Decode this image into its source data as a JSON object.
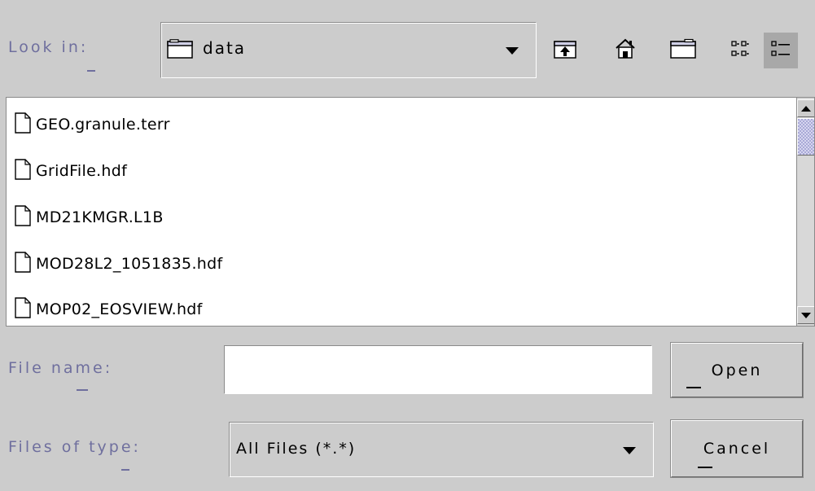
{
  "look_in": {
    "label": "Look in:",
    "folder": "data",
    "folder_icon": "folder-icon"
  },
  "toolbar": {
    "up_icon": "up-one-level-icon",
    "home_icon": "home-icon",
    "new_folder_icon": "new-folder-icon",
    "list_icon": "list-view-icon",
    "details_icon": "details-view-icon",
    "active_view": "details"
  },
  "files": [
    {
      "name": "GEO.granule.terr",
      "icon": "file-icon"
    },
    {
      "name": "GridFile.hdf",
      "icon": "file-icon"
    },
    {
      "name": "MD21KMGR.L1B",
      "icon": "file-icon"
    },
    {
      "name": "MOD28L2_1051835.hdf",
      "icon": "file-icon"
    },
    {
      "name": "MOP02_EOSVIEW.hdf",
      "icon": "file-icon"
    }
  ],
  "file_name": {
    "label": "File name:",
    "value": "",
    "placeholder": ""
  },
  "file_type": {
    "label": "Files of type:",
    "selected": "All Files (*.*)"
  },
  "buttons": {
    "open": "Open",
    "cancel": "Cancel"
  },
  "colors": {
    "label": "#6f6f9e",
    "background": "#cccccc",
    "scroll_thumb": "#a9a9d6"
  }
}
